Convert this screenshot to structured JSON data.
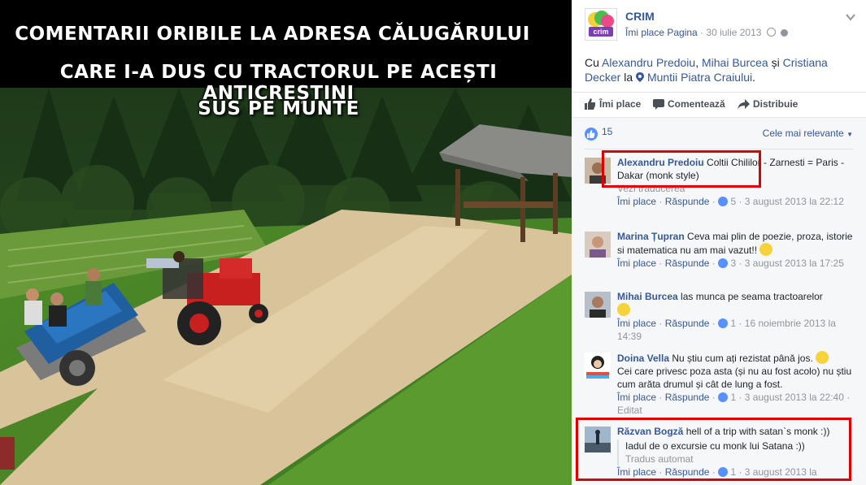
{
  "headline": {
    "line1": "COMENTARII ORIBILE LA ADRESA CĂLUGĂRULUI",
    "line2": "CARE I-A DUS CU TRACTORUL PE ACEȘTI ANTICREȘTINI",
    "line3": "SUS PE MUNTE"
  },
  "post": {
    "page_name": "CRIM",
    "logo_text": "crim",
    "meta_like": "Îmi place Pagina",
    "meta_sep": " · ",
    "date": "30 iulie 2013",
    "with_prefix": "Cu ",
    "tag1": "Alexandru Predoiu",
    "sep1": ", ",
    "tag2": "Mihai Burcea",
    "sep2": " și ",
    "tag3": "Cristiana Decker",
    "la": " la ",
    "place": "Muntii Piatra Craiului",
    "dot": "."
  },
  "actions": {
    "like": "Îmi place",
    "comment": "Comentează",
    "share": "Distribuie"
  },
  "stats": {
    "likes": "15",
    "sort": "Cele mai relevante"
  },
  "comments": [
    {
      "author": "Alexandru Predoiu",
      "text": "Coltii Chililor - Zarnesti = Paris - Dakar (monk style)",
      "see_translation": "Vezi traducerea",
      "like": "Îmi place",
      "reply": "Răspunde",
      "likes": "5",
      "date": "3 august 2013 la 22:12"
    },
    {
      "author": "Marina Țupran",
      "text": "Ceva mai plin de poezie, proza, istorie si matematica nu am mai vazut!!",
      "like": "Îmi place",
      "reply": "Răspunde",
      "likes": "3",
      "date": "3 august 2013 la 17:25"
    },
    {
      "author": "Mihai Burcea",
      "text": "las munca pe seama tractoarelor",
      "like": "Îmi place",
      "reply": "Răspunde",
      "likes": "1",
      "date": "16 noiembrie 2013 la 14:39"
    },
    {
      "author": "Doina Vella",
      "text": "Nu știu cum ați rezistat până jos.",
      "text2": "Cei care privesc poza asta (și nu au fost acolo) nu știu cum arăta drumul și cât de lung a fost.",
      "like": "Îmi place",
      "reply": "Răspunde",
      "likes": "1",
      "date": "3 august 2013 la 22:40",
      "edited": "Editat"
    },
    {
      "author": "Răzvan Bogză",
      "text": "hell of a trip with satan`s monk :))",
      "translation": "Iadul de o excursie cu monk lui Satana :))",
      "auto": "Tradus automat",
      "like": "Îmi place",
      "reply": "Răspunde",
      "likes": "1",
      "date": "3 august 2013 la"
    }
  ],
  "colors": {
    "link": "#365899",
    "highlight": "#e00000",
    "like_blue": "#5890ff"
  },
  "icons": [
    "chevron-down-icon",
    "globe-icon",
    "location-pin-icon",
    "thumbs-up-icon",
    "comment-icon",
    "share-icon",
    "like-bubble-icon",
    "smiley-emoji"
  ]
}
